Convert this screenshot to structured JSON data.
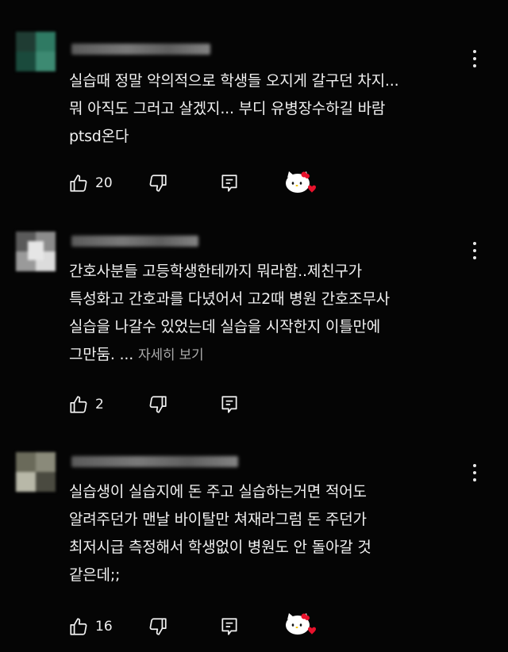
{
  "comments": [
    {
      "text_lines": [
        "실습때 정말 악의적으로 학생들 오지게 갈구던 차지...",
        "뭐 아직도 그러고 살겠지... 부디 유병장수하길 바람",
        "ptsd온다"
      ],
      "read_more": "",
      "likes": "20",
      "heart_reaction": true
    },
    {
      "text_lines": [
        "간호사분들 고등학생한테까지 뭐라함..제친구가",
        "특성화고 간호과를 다녔어서 고2때 병원 간호조무사",
        "실습을 나갈수 있었는데 실습을 시작한지 이틀만에",
        "그만둠. ..."
      ],
      "read_more": "자세히 보기",
      "likes": "2",
      "heart_reaction": false
    },
    {
      "text_lines": [
        "실습생이 실습지에 돈 주고 실습하는거면 적어도",
        "알려주던가 맨날 바이탈만 쳐재라그럼 돈 주던가",
        "최저시급 측정해서 학생없이 병원도 안 돌아갈 것",
        "같은데;;"
      ],
      "read_more": "",
      "likes": "16",
      "heart_reaction": true
    }
  ],
  "icons": {
    "like": "thumb-up-icon",
    "dislike": "thumb-down-icon",
    "reply": "reply-icon",
    "more": "more-vert-icon",
    "heart": "creator-heart-icon"
  },
  "colors": {
    "background": "#050505",
    "text": "#f1f1f1",
    "secondary_text": "#aaaaaa",
    "heart": "#e8122c"
  }
}
